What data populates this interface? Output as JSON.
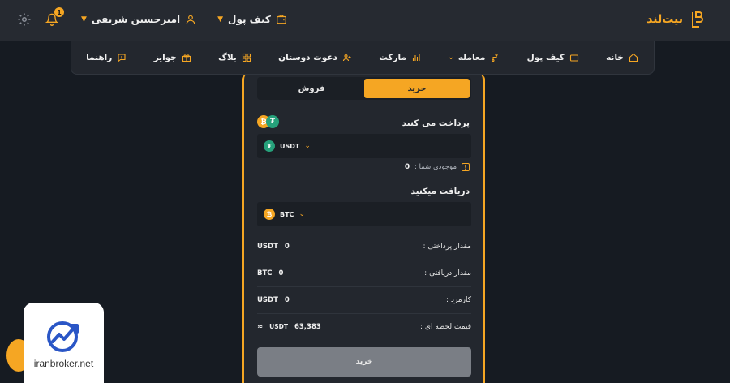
{
  "header": {
    "logo_text": "بیت‌لند",
    "wallet_label": "کیف پول",
    "user_name": "امیرحسین شریفی",
    "notification_count": "1"
  },
  "nav": {
    "items": [
      {
        "label": "خانه",
        "icon": "home-icon"
      },
      {
        "label": "کیف پول",
        "icon": "wallet-icon"
      },
      {
        "label": "معامله",
        "icon": "trade-icon"
      },
      {
        "label": "مارکت",
        "icon": "market-icon"
      },
      {
        "label": "دعوت دوستان",
        "icon": "invite-icon"
      },
      {
        "label": "بلاگ",
        "icon": "blog-icon"
      },
      {
        "label": "جوایز",
        "icon": "gift-icon"
      },
      {
        "label": "راهنما",
        "icon": "help-icon"
      }
    ]
  },
  "trade": {
    "tab_buy": "خرید",
    "tab_sell": "فروش",
    "pay_label": "پرداخت می کنید",
    "pay_coin": "USDT",
    "balance_label": "موجودی شما :",
    "balance_value": "0",
    "receive_label": "دریافت میکنید",
    "receive_coin": "BTC",
    "rows": [
      {
        "label": "مقدار پرداختی :",
        "unit": "USDT",
        "value": "0"
      },
      {
        "label": "مقدار دریافتی :",
        "unit": "BTC",
        "value": "0"
      },
      {
        "label": "کارمزد :",
        "unit": "USDT",
        "value": "0"
      },
      {
        "label": "قیمت لحظه ای :",
        "prefix": "≈",
        "unit": "USDT",
        "value": "63,383"
      }
    ],
    "submit_label": "خرید"
  },
  "watermark": {
    "text": "iranbroker.net"
  },
  "colors": {
    "accent": "#f5a623",
    "usdt": "#26a17b",
    "background": "#161b22",
    "panel": "#23272e"
  }
}
